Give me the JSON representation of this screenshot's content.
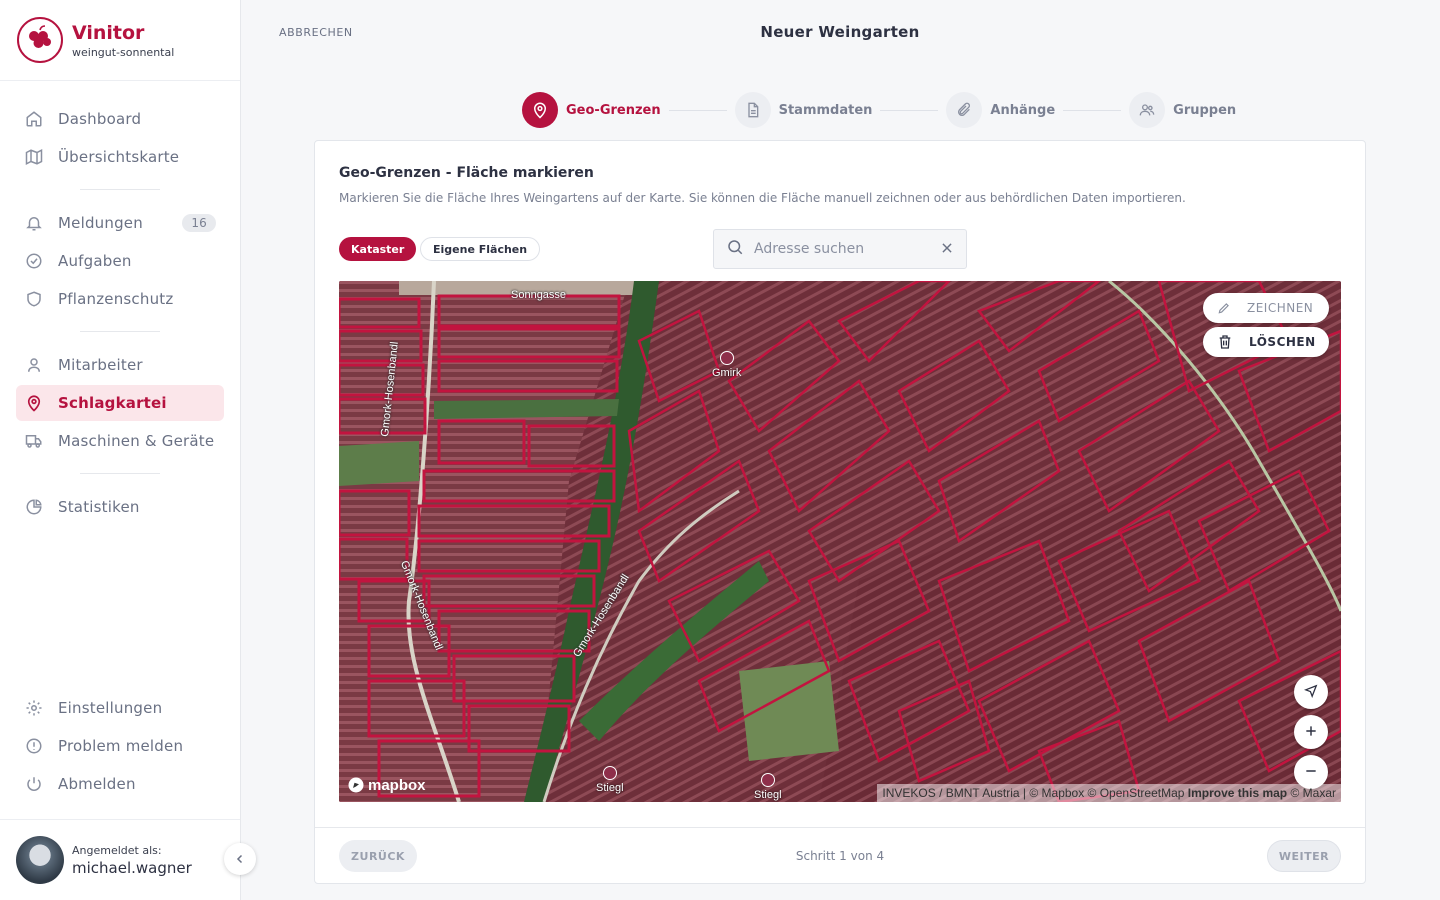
{
  "brand": {
    "name": "Vinitor",
    "subtitle": "weingut-sonnental"
  },
  "nav": {
    "main": [
      {
        "label": "Dashboard",
        "icon": "home-icon"
      },
      {
        "label": "Übersichtskarte",
        "icon": "map-icon"
      }
    ],
    "secondary": [
      {
        "label": "Meldungen",
        "icon": "bell-icon",
        "badge": "16"
      },
      {
        "label": "Aufgaben",
        "icon": "check-circle-icon"
      },
      {
        "label": "Pflanzenschutz",
        "icon": "shield-icon"
      }
    ],
    "tertiary": [
      {
        "label": "Mitarbeiter",
        "icon": "user-icon"
      },
      {
        "label": "Schlagkartei",
        "icon": "map-pin-icon",
        "active": true
      },
      {
        "label": "Maschinen & Geräte",
        "icon": "truck-icon"
      }
    ],
    "stats": {
      "label": "Statistiken",
      "icon": "pie-chart-icon"
    },
    "bottom": [
      {
        "label": "Einstellungen",
        "icon": "gear-icon"
      },
      {
        "label": "Problem melden",
        "icon": "alert-circle-icon"
      },
      {
        "label": "Abmelden",
        "icon": "power-icon"
      }
    ]
  },
  "user": {
    "label": "Angemeldet als:",
    "name": "michael.wagner"
  },
  "header": {
    "cancel": "ABBRECHEN",
    "title": "Neuer Weingarten"
  },
  "stepper": [
    {
      "label": "Geo-Grenzen",
      "icon": "map-pin-icon",
      "active": true
    },
    {
      "label": "Stammdaten",
      "icon": "document-icon"
    },
    {
      "label": "Anhänge",
      "icon": "paperclip-icon"
    },
    {
      "label": "Gruppen",
      "icon": "users-icon"
    }
  ],
  "card": {
    "title": "Geo-Grenzen - Fläche markieren",
    "description": "Markieren Sie die Fläche Ihres Weingartens auf der Karte. Sie können die Fläche manuell zeichnen oder aus behördlichen Daten importieren.",
    "chips": {
      "active": "Kataster",
      "inactive": "Eigene Flächen"
    },
    "search": {
      "placeholder": "Adresse suchen",
      "value": ""
    }
  },
  "map": {
    "draw_label": "ZEICHNEN",
    "delete_label": "LÖSCHEN",
    "logo": "mapbox",
    "attribution_prefix": "INVEKOS / BMNT Austria | © Mapbox © OpenStreetMap",
    "attribution_link": "Improve this map",
    "attribution_suffix": "© Maxar",
    "labels": {
      "road_top": "Sonngasse",
      "road_left_upper": "Gmork-Hosenbandl",
      "road_left_lower": "Gmork-Hosenbandl",
      "road_center": "Gmork-Hosenbandl"
    },
    "pois": {
      "gmirk": "Gmirk",
      "stiegl_1": "Stiegl",
      "stiegl_2": "Stiegl"
    },
    "colors": {
      "parcel_outline": "#c2143f",
      "accent": "#b5123f"
    }
  },
  "footer": {
    "back": "ZURÜCK",
    "step_text": "Schritt 1 von 4",
    "next": "WEITER"
  }
}
